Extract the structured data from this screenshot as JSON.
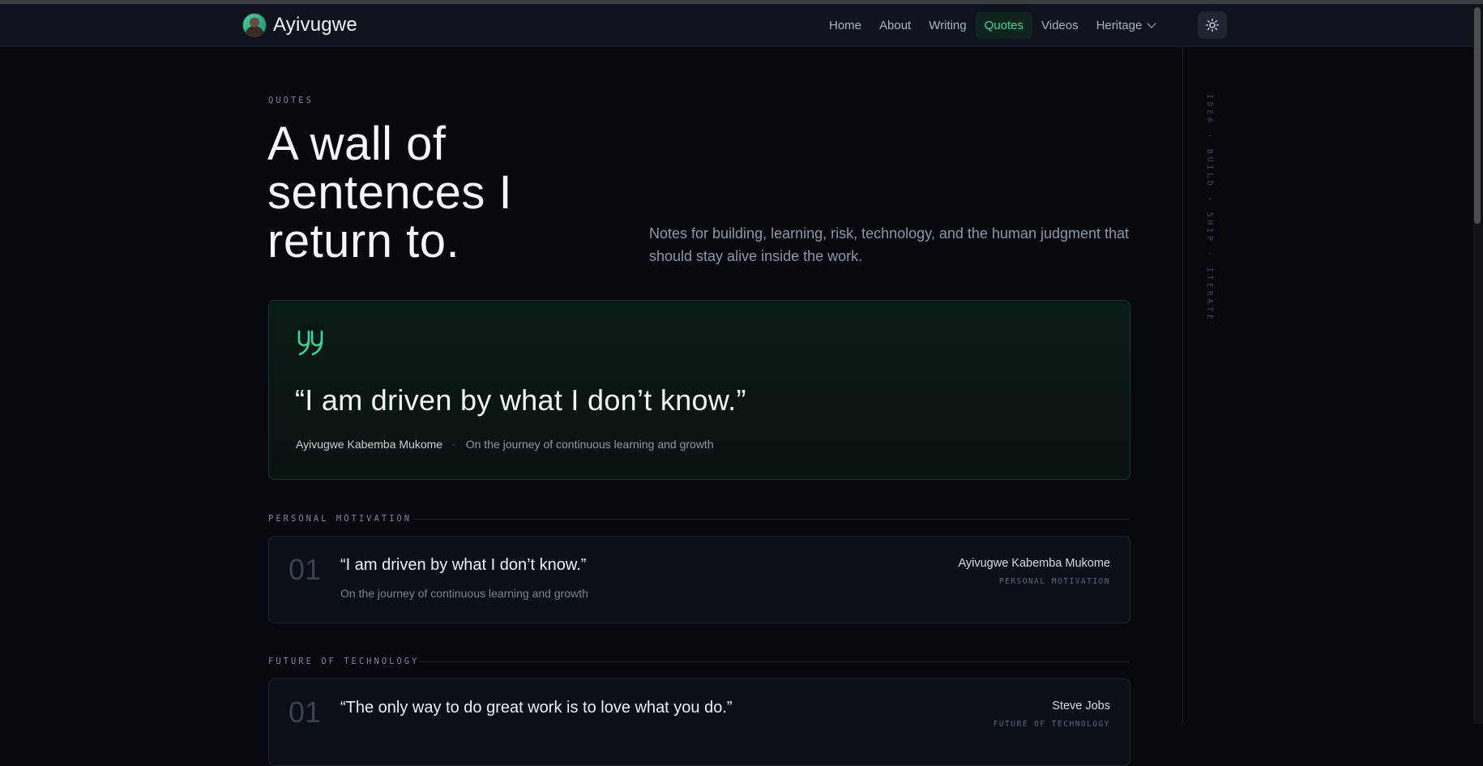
{
  "header": {
    "brand": "Ayivugwe",
    "nav": [
      "Home",
      "About",
      "Writing",
      "Quotes",
      "Videos",
      "Heritage"
    ],
    "active_nav": "Quotes",
    "theme_icon": "sun-icon"
  },
  "rail": {
    "text": "IDEA · BUILD · SHIP · ITERATE"
  },
  "hero": {
    "eyebrow": "QUOTES",
    "title": "A wall of sentences I return to.",
    "subtitle": "Notes for building, learning, risk, technology, and the human judgment that should stay alive inside the work."
  },
  "featured": {
    "icon": "quote-icon",
    "quote": "“I am driven by what I don’t know.”",
    "author": "Ayivugwe Kabemba Mukome",
    "separator": "·",
    "context": "On the journey of continuous learning and growth"
  },
  "sections": [
    {
      "label": "PERSONAL MOTIVATION",
      "card": {
        "number": "01",
        "quote": "“I am driven by what I don’t know.”",
        "note": "On the journey of continuous learning and growth",
        "author": "Ayivugwe Kabemba Mukome",
        "category": "PERSONAL MOTIVATION"
      }
    },
    {
      "label": "FUTURE OF TECHNOLOGY",
      "card": {
        "number": "01",
        "quote": "“The only way to do great work is to love what you do.”",
        "note": "",
        "author": "Steve Jobs",
        "category": "FUTURE OF TECHNOLOGY"
      }
    }
  ],
  "colors": {
    "accent": "#43d39a",
    "background": "#07090f"
  }
}
